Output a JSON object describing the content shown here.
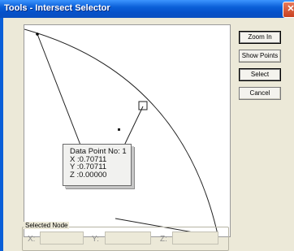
{
  "window": {
    "title": "Tools - Intersect Selector",
    "close_glyph": "✕"
  },
  "buttons": {
    "zoom_in": "Zoom In",
    "show_points": "Show Points",
    "select": "Select",
    "cancel": "Cancel"
  },
  "data_point": {
    "title": "Data Point No: 1",
    "x": "X :0.70711",
    "y": "Y :0.70711",
    "z": "Z :0.00000"
  },
  "selected_node": {
    "label": "Selected Node",
    "x_label": "X:",
    "y_label": "Y:",
    "z_label": "Z:",
    "x_value": "",
    "y_value": "",
    "z_value": ""
  },
  "colors": {
    "title_bar": "#0a5fd8",
    "dialog_bg": "#ece9d8",
    "canvas_bg": "#ffffff"
  }
}
